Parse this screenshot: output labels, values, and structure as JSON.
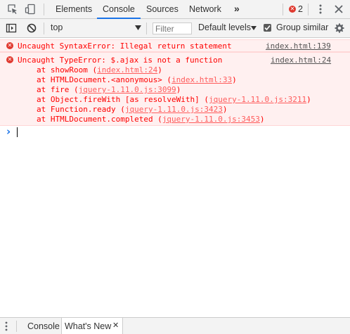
{
  "tabbar": {
    "tabs": [
      {
        "label": "Elements"
      },
      {
        "label": "Console"
      },
      {
        "label": "Sources"
      },
      {
        "label": "Network"
      }
    ],
    "more_label": "»",
    "error_count": "2"
  },
  "toolbar": {
    "context_value": "top",
    "filter_placeholder": "Filter",
    "levels_label": "Default levels",
    "group_similar_label": "Group similar",
    "group_similar_checked": true
  },
  "console": {
    "messages": [
      {
        "text": "Uncaught SyntaxError: Illegal return statement",
        "source": "index.html:139"
      },
      {
        "text": "Uncaught TypeError: $.ajax is not a function",
        "source": "index.html:24",
        "stack": [
          {
            "prefix": "at showRoom (",
            "link": "index.html:24",
            "suffix": ")"
          },
          {
            "prefix": "at HTMLDocument.<anonymous> (",
            "link": "index.html:33",
            "suffix": ")"
          },
          {
            "prefix": "at fire (",
            "link": "jquery-1.11.0.js:3099",
            "suffix": ")"
          },
          {
            "prefix": "at Object.fireWith [as resolveWith] (",
            "link": "jquery-1.11.0.js:3211",
            "suffix": ")"
          },
          {
            "prefix": "at Function.ready (",
            "link": "jquery-1.11.0.js:3423",
            "suffix": ")"
          },
          {
            "prefix": "at HTMLDocument.completed (",
            "link": "jquery-1.11.0.js:3453",
            "suffix": ")"
          }
        ]
      }
    ],
    "prompt_symbol": "›"
  },
  "drawer": {
    "tabs": [
      {
        "label": "Console"
      },
      {
        "label": "What's New"
      }
    ],
    "close_symbol": "✕"
  },
  "colors": {
    "error_text": "#ff0000",
    "error_bg": "#fff0f0",
    "accent": "#1a73e8",
    "prompt": "#1a73e8"
  }
}
